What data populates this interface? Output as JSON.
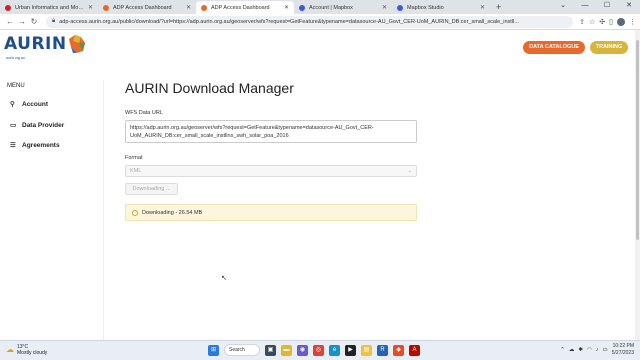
{
  "browser": {
    "tabs": [
      {
        "label": "Urban Informatics and Modelling",
        "favicon_color": "#cc2222",
        "active": false
      },
      {
        "label": "ADP Access Dashboard",
        "favicon_color": "#e8692b",
        "active": false
      },
      {
        "label": "ADP Access Dashboard",
        "favicon_color": "#e8692b",
        "active": true
      },
      {
        "label": "Account | Mapbox",
        "favicon_color": "#3b5bdb",
        "active": false
      },
      {
        "label": "Mapbox Studio",
        "favicon_color": "#3b5bdb",
        "active": false
      }
    ],
    "new_tab": "+",
    "url": "adp-access.aurin.org.au/public/download/?url=https://adp.aurin.org.au/geoserver/wfs?request=GetFeature&typename=datasource-AU_Govt_CER-UoM_AURIN_DB:cer_small_scale_instll..."
  },
  "header": {
    "logo_text": "AURIN",
    "logo_sub": "aurin.org.au",
    "data_catalogue": "DATA CATALOGUE",
    "training": "TRAINING"
  },
  "sidebar": {
    "title": "MENU",
    "items": [
      {
        "label": "Account",
        "icon": "user-icon"
      },
      {
        "label": "Data Provider",
        "icon": "folder-icon"
      },
      {
        "label": "Agreements",
        "icon": "list-icon"
      }
    ]
  },
  "main": {
    "title": "AURIN Download Manager",
    "wfs_label": "WFS Data URL",
    "wfs_url": "https://adp.aurin.org.au/geoserver/wfs?request=GetFeature&typename=datasource-AU_Govt_CER-UoM_AURIN_DB:cer_small_scale_instllns_swh_solar_poa_2016",
    "format_label": "Format",
    "format_value": "KML",
    "download_button": "Downloading ...",
    "status_text": "Downloading - 26.54 MB"
  },
  "taskbar": {
    "weather_temp": "13°C",
    "weather_desc": "Mostly cloudy",
    "search_label": "Search",
    "time": "10:22 PM",
    "date": "5/27/2023"
  },
  "colors": {
    "accent_orange": "#e8692b",
    "accent_gold": "#d6b53a",
    "brand_blue": "#1f4f8a",
    "status_bg": "#fdf6dc"
  }
}
